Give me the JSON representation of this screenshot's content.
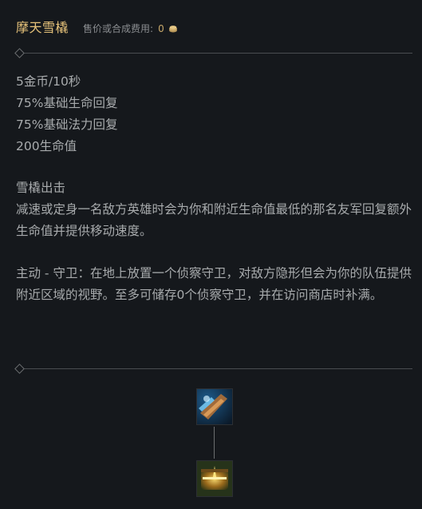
{
  "header": {
    "item_name": "摩天雪橇",
    "price_label": "售价或合成费用:",
    "price_value": "0",
    "price_icon": "gold-coin-icon"
  },
  "stats": [
    "5金币/10秒",
    "75%基础生命回复",
    "75%基础法力回复",
    "200生命值"
  ],
  "passive": {
    "title": "雪橇出击",
    "text": "减速或定身一名敌方英雄时会为你和附近生命值最低的那名友军回复额外生命值并提供移动速度。"
  },
  "active": {
    "text": "主动 - 守卫：在地上放置一个侦察守卫，对敌方隐形但会为你的队伍提供附近区域的视野。至多可储存0个侦察守卫，并在访问商店时补满。"
  },
  "build_tree": {
    "items": [
      {
        "icon": "frostfang-item-icon"
      },
      {
        "icon": "runesteel-spaulders-item-icon"
      }
    ]
  },
  "colors": {
    "background": "#15181c",
    "title": "#e6c27a",
    "body_text": "#a8abad",
    "muted": "#8a8d90",
    "divider": "#4a4d50"
  }
}
